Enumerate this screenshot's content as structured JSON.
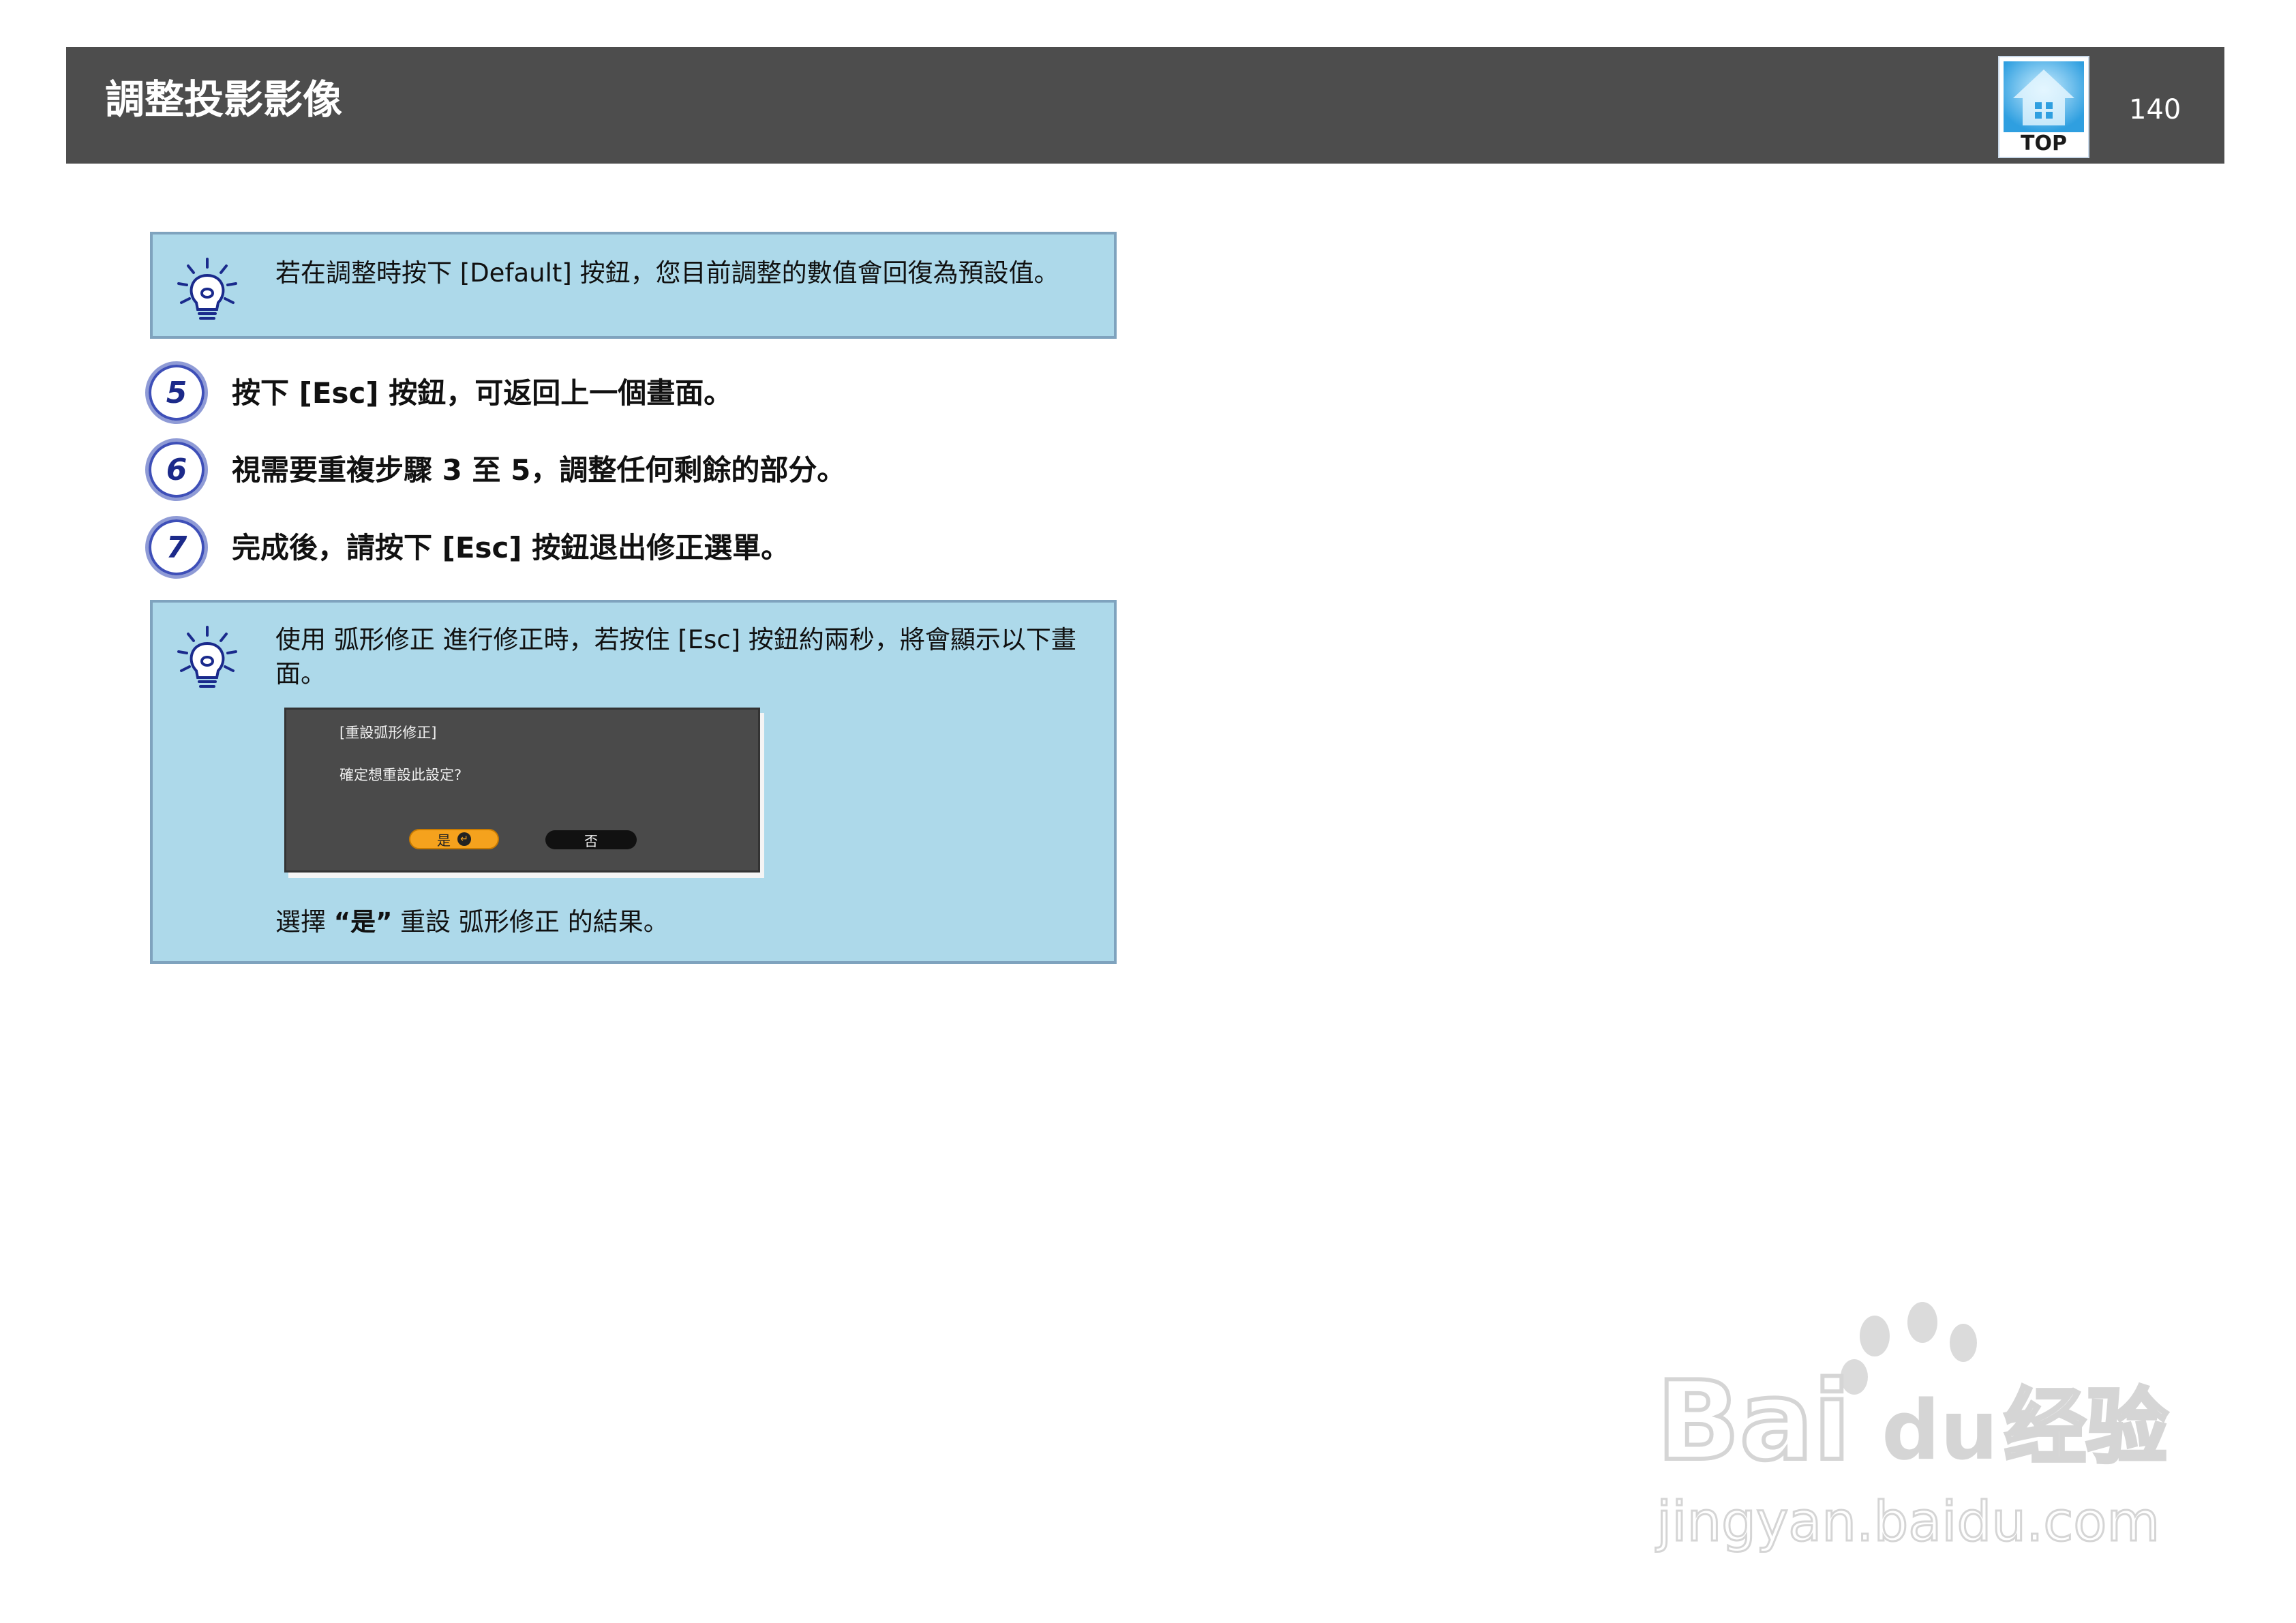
{
  "header": {
    "title": "調整投影影像",
    "top_label": "TOP",
    "page_number": "140"
  },
  "note1": {
    "text": "若在調整時按下 [Default] 按鈕，您目前調整的數值會回復為預設值。"
  },
  "steps": [
    {
      "num": "5",
      "text": "按下 [Esc] 按鈕，可返回上一個畫面。"
    },
    {
      "num": "6",
      "text": "視需要重複步驟 3 至 5，調整任何剩餘的部分。"
    },
    {
      "num": "7",
      "text": "完成後，請按下 [Esc] 按鈕退出修正選單。"
    }
  ],
  "note2": {
    "text": "使用 弧形修正 進行修正時，若按住 [Esc] 按鈕約兩秒，將會顯示以下畫面。",
    "dialog": {
      "title": "[重設弧形修正]",
      "question": "確定想重設此設定?",
      "yes_label": "是",
      "no_label": "否"
    },
    "bottom_pre": "選擇 ",
    "bottom_bold": "“是”",
    "bottom_post": " 重設 弧形修正 的結果。"
  },
  "watermark": {
    "line1_latin": "Bai",
    "line1_du": "du",
    "line1_cjk": "经验",
    "line2": "jingyan.baidu.com"
  }
}
